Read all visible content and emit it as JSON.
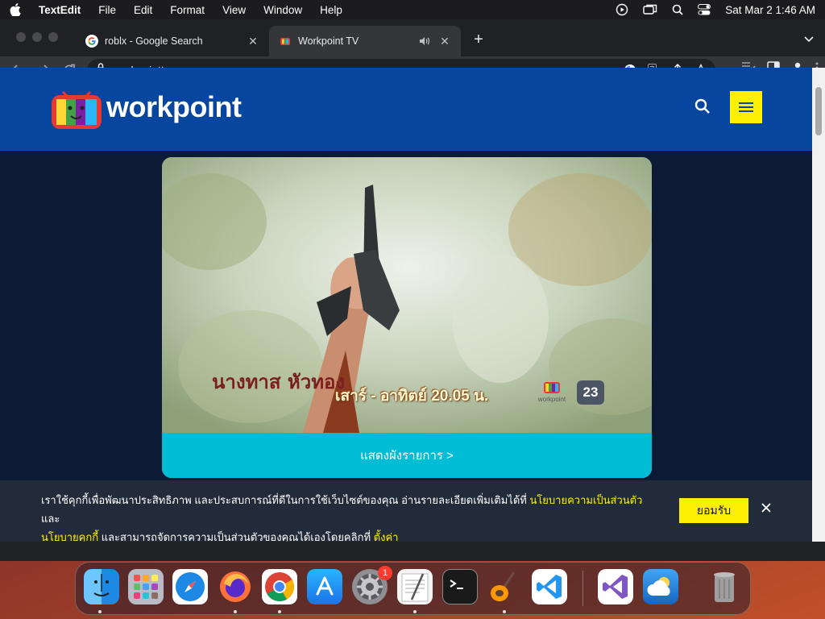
{
  "menubar": {
    "app_name": "TextEdit",
    "items": [
      "File",
      "Edit",
      "Format",
      "View",
      "Window",
      "Help"
    ],
    "clock": "Sat Mar 2  1:46 AM"
  },
  "browser": {
    "tabs": [
      {
        "title": "roblx - Google Search",
        "favicon": "google-icon"
      },
      {
        "title": "Workpoint TV",
        "favicon": "workpoint-icon",
        "audio": true
      }
    ],
    "url": "workpointtv.com"
  },
  "site": {
    "logo_text": "workpoint",
    "banner": {
      "show_logo_text": "นางทาส หัวทอง",
      "showtime": "เสาร์ - อาทิตย์ 20.05 น.",
      "channel_number": "23",
      "channel_logo_text": "workpoint",
      "cta_label": "แสดงผังรายการ >"
    },
    "cookie": {
      "text_part1": "เราใช้คุกกี้เพื่อพัฒนาประสิทธิภาพ และประสบการณ์ที่ดีในการใช้เว็บไซต์ของคุณ อ่านรายละเอียดเพิ่มเติมได้ที่ ",
      "link_privacy": "นโยบายความเป็นส่วนตัว",
      "text_part2": " และ",
      "link_cookie": "นโยบายคุกกี้",
      "text_part3": " และสามารถจัดการความเป็นส่วนตัวของคุณได้เองโดยคลิกที่ ",
      "link_settings": "ตั้งค่า",
      "accept_label": "ยอมรับ"
    }
  },
  "dock": {
    "apps": [
      "finder",
      "launchpad",
      "safari",
      "firefox",
      "chrome",
      "app-store",
      "system-preferences",
      "textedit",
      "terminal",
      "garageband",
      "vscode",
      "visual-studio",
      "weather",
      "trash"
    ],
    "system_preferences_badge": "1"
  },
  "colors": {
    "site_header": "#07469e",
    "accent_yellow": "#ffef00",
    "cta_cyan": "#00bcd4"
  }
}
